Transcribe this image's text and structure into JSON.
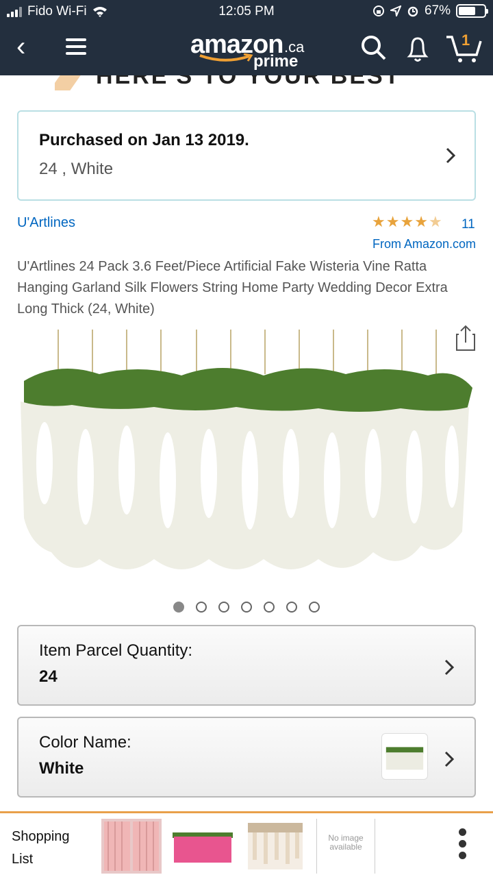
{
  "status": {
    "carrier": "Fido Wi-Fi",
    "time": "12:05 PM",
    "battery": "67%",
    "battery_level": 0.67
  },
  "header": {
    "logo_word": "amazon",
    "logo_tld": ".ca",
    "logo_prime": "prime",
    "cart_count": "1"
  },
  "banner": {
    "text": "HERE'S TO YOUR BEST YEAR"
  },
  "purchase": {
    "line1": "Purchased on Jan 13 2019.",
    "line2": "24 , White"
  },
  "product": {
    "brand": "U'Artlines",
    "rating": 4.5,
    "rating_count": "11",
    "from": "From Amazon.com",
    "title": "U'Artlines 24 Pack 3.6 Feet/Piece Artificial Fake Wisteria Vine Ratta Hanging Garland Silk Flowers String Home Party Wedding Decor Extra Long Thick (24, White)"
  },
  "gallery": {
    "current": 1,
    "total": 7
  },
  "options": {
    "quantity_label": "Item Parcel Quantity:",
    "quantity_value": "24",
    "color_label": "Color Name:",
    "color_value": "White"
  },
  "footer": {
    "list_label": "Shopping List",
    "no_image": "No image available"
  },
  "colors": {
    "header_bg": "#232f3e",
    "link": "#0066c0",
    "star": "#e8a33c",
    "accent": "#e9a04a"
  }
}
